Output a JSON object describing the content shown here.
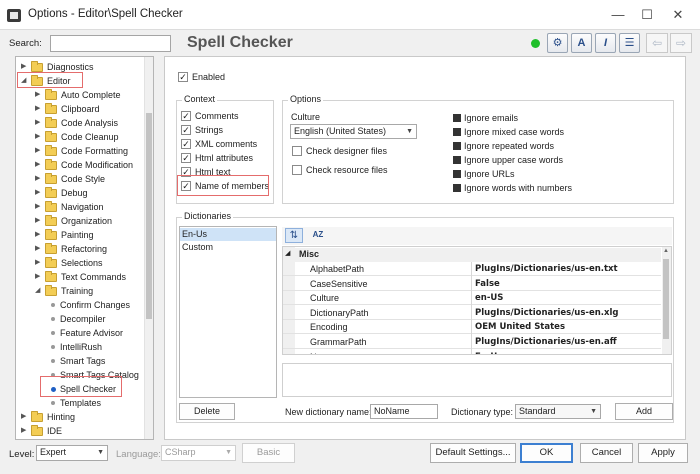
{
  "window": {
    "title": "Options - Editor\\Spell Checker",
    "minimize": "—",
    "maximize": "☐",
    "close": "✕"
  },
  "search": {
    "label": "Search:",
    "value": ""
  },
  "page_title": "Spell Checker",
  "toolbar": {
    "btn1": "⚙",
    "btn2": "A",
    "btn3": "I",
    "btn4": "☰",
    "back": "⇦",
    "forward": "⇨"
  },
  "tree": {
    "diagnostics": "Diagnostics",
    "editor": "Editor",
    "children": [
      "Auto Complete",
      "Clipboard",
      "Code Analysis",
      "Code Cleanup",
      "Code Formatting",
      "Code Modification",
      "Code Style",
      "Debug",
      "Navigation",
      "Organization",
      "Painting",
      "Refactoring",
      "Selections",
      "Text Commands",
      "Training"
    ],
    "leaves": [
      "Confirm Changes",
      "Decompiler",
      "Feature Advisor",
      "IntelliRush",
      "Smart Tags",
      "Smart Tags Catalog",
      "Spell Checker",
      "Templates"
    ],
    "after": [
      "Hinting",
      "IDE"
    ]
  },
  "enabled": {
    "label": "Enabled",
    "checked": "✓"
  },
  "context": {
    "title": "Context",
    "items": [
      "Comments",
      "Strings",
      "XML comments",
      "Html attributes",
      "Html text",
      "Name of members"
    ],
    "check": "✓"
  },
  "options": {
    "title": "Options",
    "culture_label": "Culture",
    "culture_value": "English (United States)",
    "check_designer": "Check designer files",
    "check_resource": "Check resource files",
    "ignore": [
      "Ignore emails",
      "Ignore mixed case words",
      "Ignore repeated words",
      "Ignore upper case words",
      "Ignore URLs",
      "Ignore words with numbers"
    ]
  },
  "dictionaries": {
    "title": "Dictionaries",
    "list": [
      "En-Us",
      "Custom"
    ],
    "sort_categorized": "⇅",
    "sort_alpha": "AZ",
    "category": "Misc",
    "properties": [
      {
        "k": "AlphabetPath",
        "v": "PlugIns/Dictionaries/us-en.txt"
      },
      {
        "k": "CaseSensitive",
        "v": "False"
      },
      {
        "k": "Culture",
        "v": "en-US"
      },
      {
        "k": "DictionaryPath",
        "v": "PlugIns/Dictionaries/us-en.xlg"
      },
      {
        "k": "Encoding",
        "v": "OEM United States"
      },
      {
        "k": "GrammarPath",
        "v": "PlugIns/Dictionaries/us-en.aff"
      },
      {
        "k": "Name",
        "v": "En-Us"
      }
    ],
    "delete_label": "Delete",
    "new_name_label": "New dictionary name:",
    "new_name_value": "NoName",
    "type_label": "Dictionary type:",
    "type_value": "Standard",
    "add_label": "Add"
  },
  "footer": {
    "level_label": "Level:",
    "level_value": "Expert",
    "language_label": "Language:",
    "language_value": "CSharp",
    "basic_label": "Basic",
    "default_settings": "Default Settings...",
    "ok": "OK",
    "cancel": "Cancel",
    "apply": "Apply"
  }
}
